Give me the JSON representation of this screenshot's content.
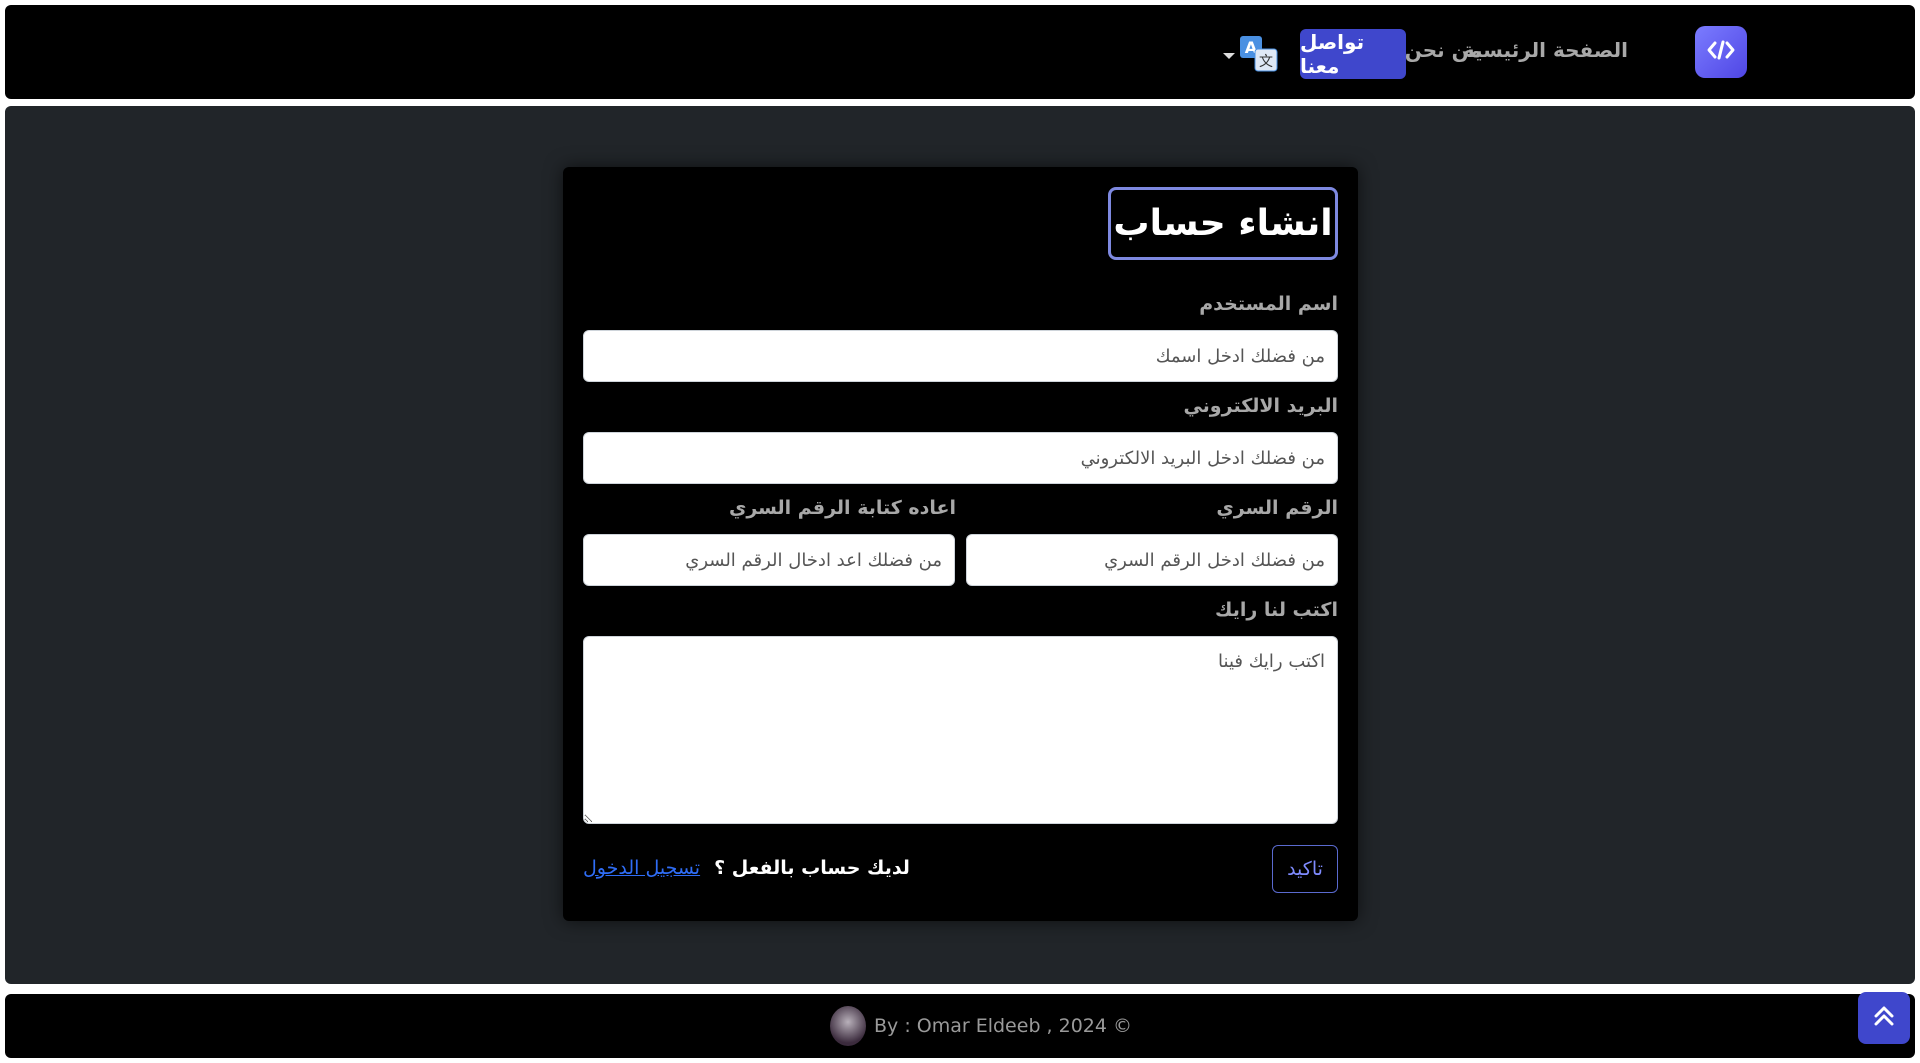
{
  "nav": {
    "home": "الصفحة الرئيسية",
    "about": "من نحن",
    "contact": "تواصل معنا",
    "logo_icon": "code-icon",
    "lang_icon": "translate-icon"
  },
  "form": {
    "title": "انشاء حساب",
    "username_label": "اسم المستخدم",
    "username_placeholder": "من فضلك ادخل اسمك",
    "email_label": "البريد الالكتروني",
    "email_placeholder": "من فضلك ادخل البريد الالكتروني",
    "password_label": "الرقم السري",
    "password_placeholder": "من فضلك ادخل الرقم السري",
    "confirm_label": "اعاده كتابة الرقم السري",
    "confirm_placeholder": "من فضلك اعد ادخال الرقم السري",
    "feedback_label": "اكتب لنا رايك",
    "feedback_placeholder": "اكتب رايك فينا",
    "submit": "تاكيد",
    "have_account": "لديك حساب بالفعل ؟",
    "login_link": "تسجيل الدخول"
  },
  "footer": {
    "text": "By : Omar Eldeeb , 2024 ©"
  },
  "colors": {
    "accent": "#3f47cc",
    "link": "#2f6df6",
    "bg": "#212529"
  }
}
